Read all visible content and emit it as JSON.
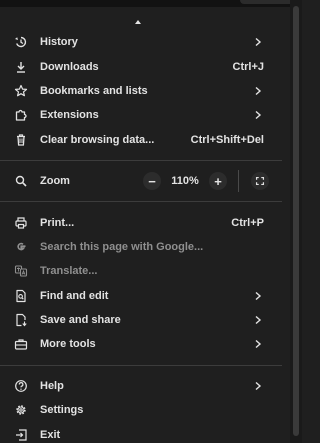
{
  "menu": {
    "history": {
      "label": "History",
      "icon": "history-icon"
    },
    "downloads": {
      "label": "Downloads",
      "shortcut": "Ctrl+J",
      "icon": "download-icon"
    },
    "bookmarks": {
      "label": "Bookmarks and lists",
      "icon": "star-icon"
    },
    "extensions": {
      "label": "Extensions",
      "icon": "extension-icon"
    },
    "clear_data": {
      "label": "Clear browsing data...",
      "shortcut": "Ctrl+Shift+Del",
      "icon": "trash-icon"
    },
    "zoom": {
      "label": "Zoom",
      "value": "110%",
      "minus": "−",
      "plus": "+",
      "icon": "zoom-icon"
    },
    "print": {
      "label": "Print...",
      "shortcut": "Ctrl+P",
      "icon": "printer-icon"
    },
    "search_page": {
      "label": "Search this page with Google...",
      "icon": "google-g-icon"
    },
    "translate": {
      "label": "Translate...",
      "icon": "translate-icon"
    },
    "find_edit": {
      "label": "Find and edit",
      "icon": "find-icon"
    },
    "save_share": {
      "label": "Save and share",
      "icon": "save-share-icon"
    },
    "more_tools": {
      "label": "More tools",
      "icon": "toolbox-icon"
    },
    "help": {
      "label": "Help",
      "icon": "help-icon"
    },
    "settings": {
      "label": "Settings",
      "icon": "gear-icon"
    },
    "exit": {
      "label": "Exit",
      "icon": "exit-icon"
    }
  },
  "colors": {
    "background": "#1f1f1f",
    "text": "#e3e3e3",
    "disabled_text": "#8f8f8f",
    "separator": "#3c3c3c"
  }
}
